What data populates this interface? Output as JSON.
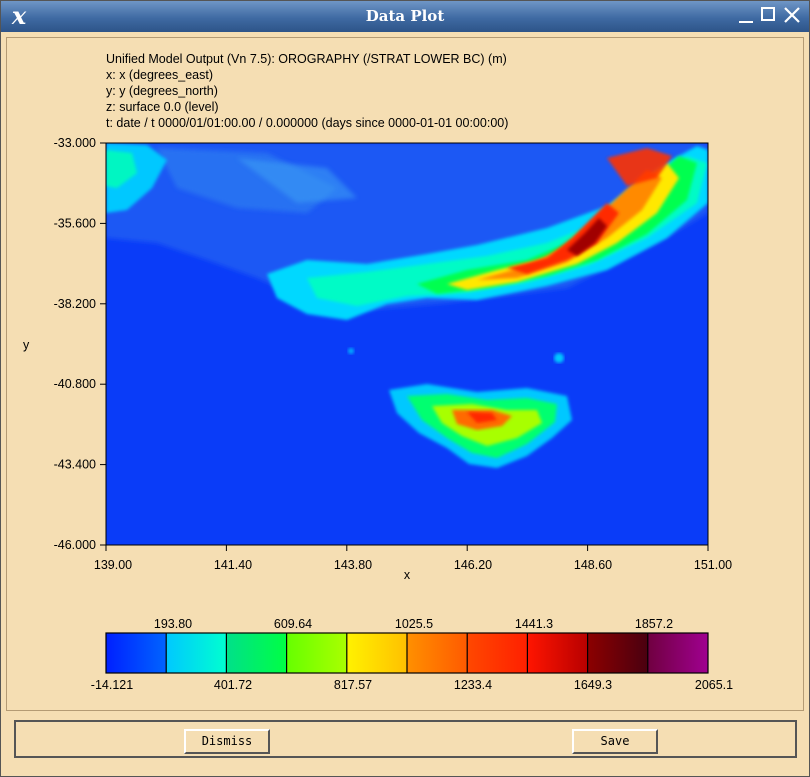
{
  "window": {
    "title": "Data Plot",
    "logo_glyph": "x"
  },
  "plot": {
    "header_lines": [
      "Unified Model Output (Vn 7.5): OROGRAPHY (/STRAT LOWER BC) (m)",
      "x: x  (degrees_east)",
      "y: y  (degrees_north)",
      "z: surface 0.0 (level)",
      "t: date / t 0000/01/01:00.00 / 0.000000 (days since 0000-01-01 00:00:00)"
    ],
    "xlabel": "x",
    "ylabel": "y",
    "x_ticks": [
      "139.00",
      "141.40",
      "143.80",
      "146.20",
      "148.60",
      "151.00"
    ],
    "y_ticks": [
      "-33.000",
      "-35.600",
      "-38.200",
      "-40.800",
      "-43.400",
      "-46.000"
    ],
    "xlim": [
      139.0,
      151.0
    ],
    "ylim": [
      -46.0,
      -33.0
    ]
  },
  "colorbar": {
    "labels_top": [
      "193.80",
      "609.64",
      "1025.5",
      "1441.3",
      "1857.2"
    ],
    "labels_bottom": [
      "-14.121",
      "401.72",
      "817.57",
      "1233.4",
      "1649.3",
      "2065.1"
    ],
    "colors": [
      [
        "#0020ff",
        "#0064ff"
      ],
      [
        "#00c8ff",
        "#00ffd0"
      ],
      [
        "#00e08a",
        "#00ff44"
      ],
      [
        "#66ff00",
        "#aaff00"
      ],
      [
        "#fff200",
        "#ffc000"
      ],
      [
        "#ff9000",
        "#ff5a00"
      ],
      [
        "#ff4800",
        "#ff2000"
      ],
      [
        "#ff1500",
        "#b80000"
      ],
      [
        "#8c0000",
        "#4a0010"
      ],
      [
        "#700040",
        "#a00090"
      ]
    ],
    "min": -14.121,
    "max": 2065.1
  },
  "buttons": {
    "dismiss": "Dismiss",
    "save": "Save"
  }
}
